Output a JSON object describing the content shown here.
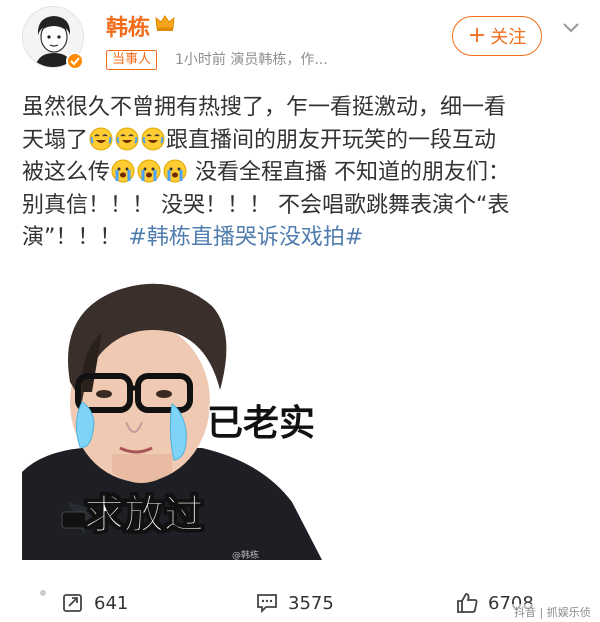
{
  "author": {
    "name": "韩栋",
    "tag": "当事人",
    "meta": "1小时前  演员韩栋，作...",
    "follow_label": "关注"
  },
  "post": {
    "lines": [
      {
        "text": "虽然很久不曾拥有热搜了，乍一看挺激动，细一看"
      },
      {
        "before": "天塌了",
        "after": "跟直播间的朋友开玩笑的一段互动"
      },
      {
        "before": "被这么传",
        "after": " 没看全程直播 不知道的朋友们："
      },
      {
        "text": "别真信！！！ 没哭！！！ 不会唱歌跳舞表演个“表"
      },
      {
        "before": "演”！！！ ",
        "hashtag": "#韩栋直播哭诉没戏拍#"
      }
    ]
  },
  "image": {
    "caption_top": "已老实",
    "caption_bottom": "求放过",
    "watermark": "@韩栋"
  },
  "actions": {
    "repost_count": "641",
    "comment_count": "3575",
    "like_count": "6708"
  },
  "watermark": "抖音 | 抓娱乐侦探",
  "colors": {
    "accent": "#f26d1b",
    "hashtag": "#507daf",
    "text": "#333333",
    "meta": "#8f8f8f"
  }
}
